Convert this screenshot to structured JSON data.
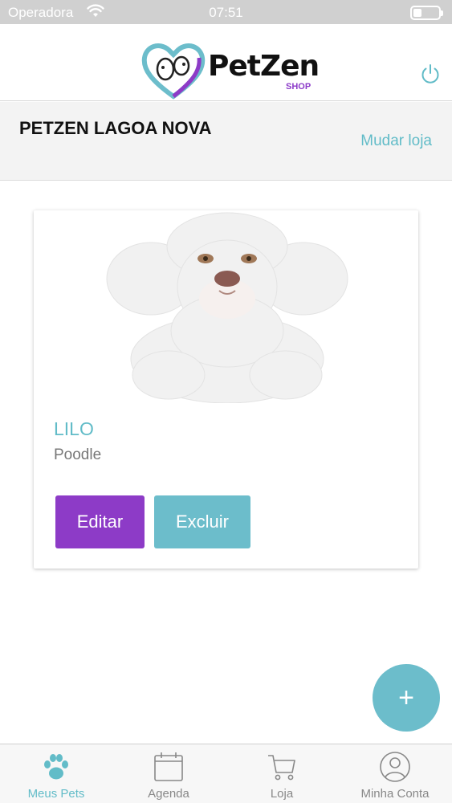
{
  "status_bar": {
    "carrier": "Operadora",
    "time": "07:51"
  },
  "header": {
    "logo_text": "PetZen",
    "logo_subtext": "SHOP"
  },
  "store": {
    "name": "PETZEN LAGOA NOVA",
    "change_label": "Mudar loja"
  },
  "pet_card": {
    "name": "LILO",
    "breed": "Poodle",
    "edit_label": "Editar",
    "delete_label": "Excluir"
  },
  "fab": {
    "label": "+"
  },
  "tabbar": {
    "items": [
      {
        "label": "Meus Pets",
        "icon": "paw-icon",
        "active": true
      },
      {
        "label": "Agenda",
        "icon": "calendar-icon",
        "active": false
      },
      {
        "label": "Loja",
        "icon": "cart-icon",
        "active": false
      },
      {
        "label": "Minha Conta",
        "icon": "user-icon",
        "active": false
      }
    ]
  },
  "colors": {
    "accent_teal": "#62bcc8",
    "accent_purple": "#8d3bc7"
  }
}
